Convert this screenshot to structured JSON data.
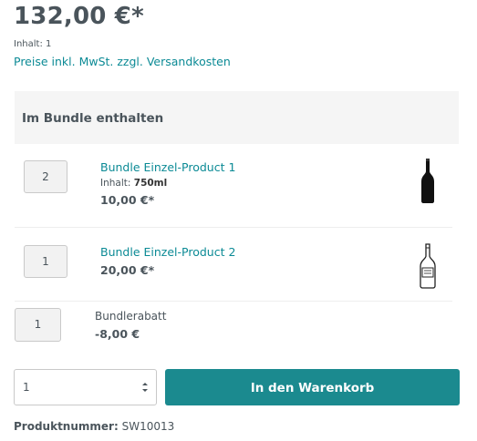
{
  "product": {
    "price": "132,00 €*",
    "content_label": "Inhalt:",
    "content_value": "1",
    "tax_link": "Preise inkl. MwSt. zzgl. Versandkosten"
  },
  "bundle": {
    "title": "Im Bundle enthalten",
    "items": [
      {
        "quantity": "2",
        "name": "Bundle Einzel-Product 1",
        "content_label": "Inhalt:",
        "content_value": "750ml",
        "price": "10,00 €*",
        "icon": "dark-wine-bottle-icon"
      },
      {
        "quantity": "1",
        "name": "Bundle Einzel-Product 2",
        "price": "20,00 €*",
        "icon": "outline-wine-bottle-icon"
      }
    ],
    "discount": {
      "quantity": "1",
      "label": "Bundlerabatt",
      "price": "-8,00 €"
    }
  },
  "buy": {
    "quantity_selected": "1",
    "button_label": "In den Warenkorb"
  },
  "product_number": {
    "label": "Produktnummer:",
    "value": "SW10013"
  },
  "colors": {
    "accent": "#1b8a8f",
    "link": "#0b8a95",
    "text": "#4a545b",
    "header_bg": "#f5f5f5"
  }
}
